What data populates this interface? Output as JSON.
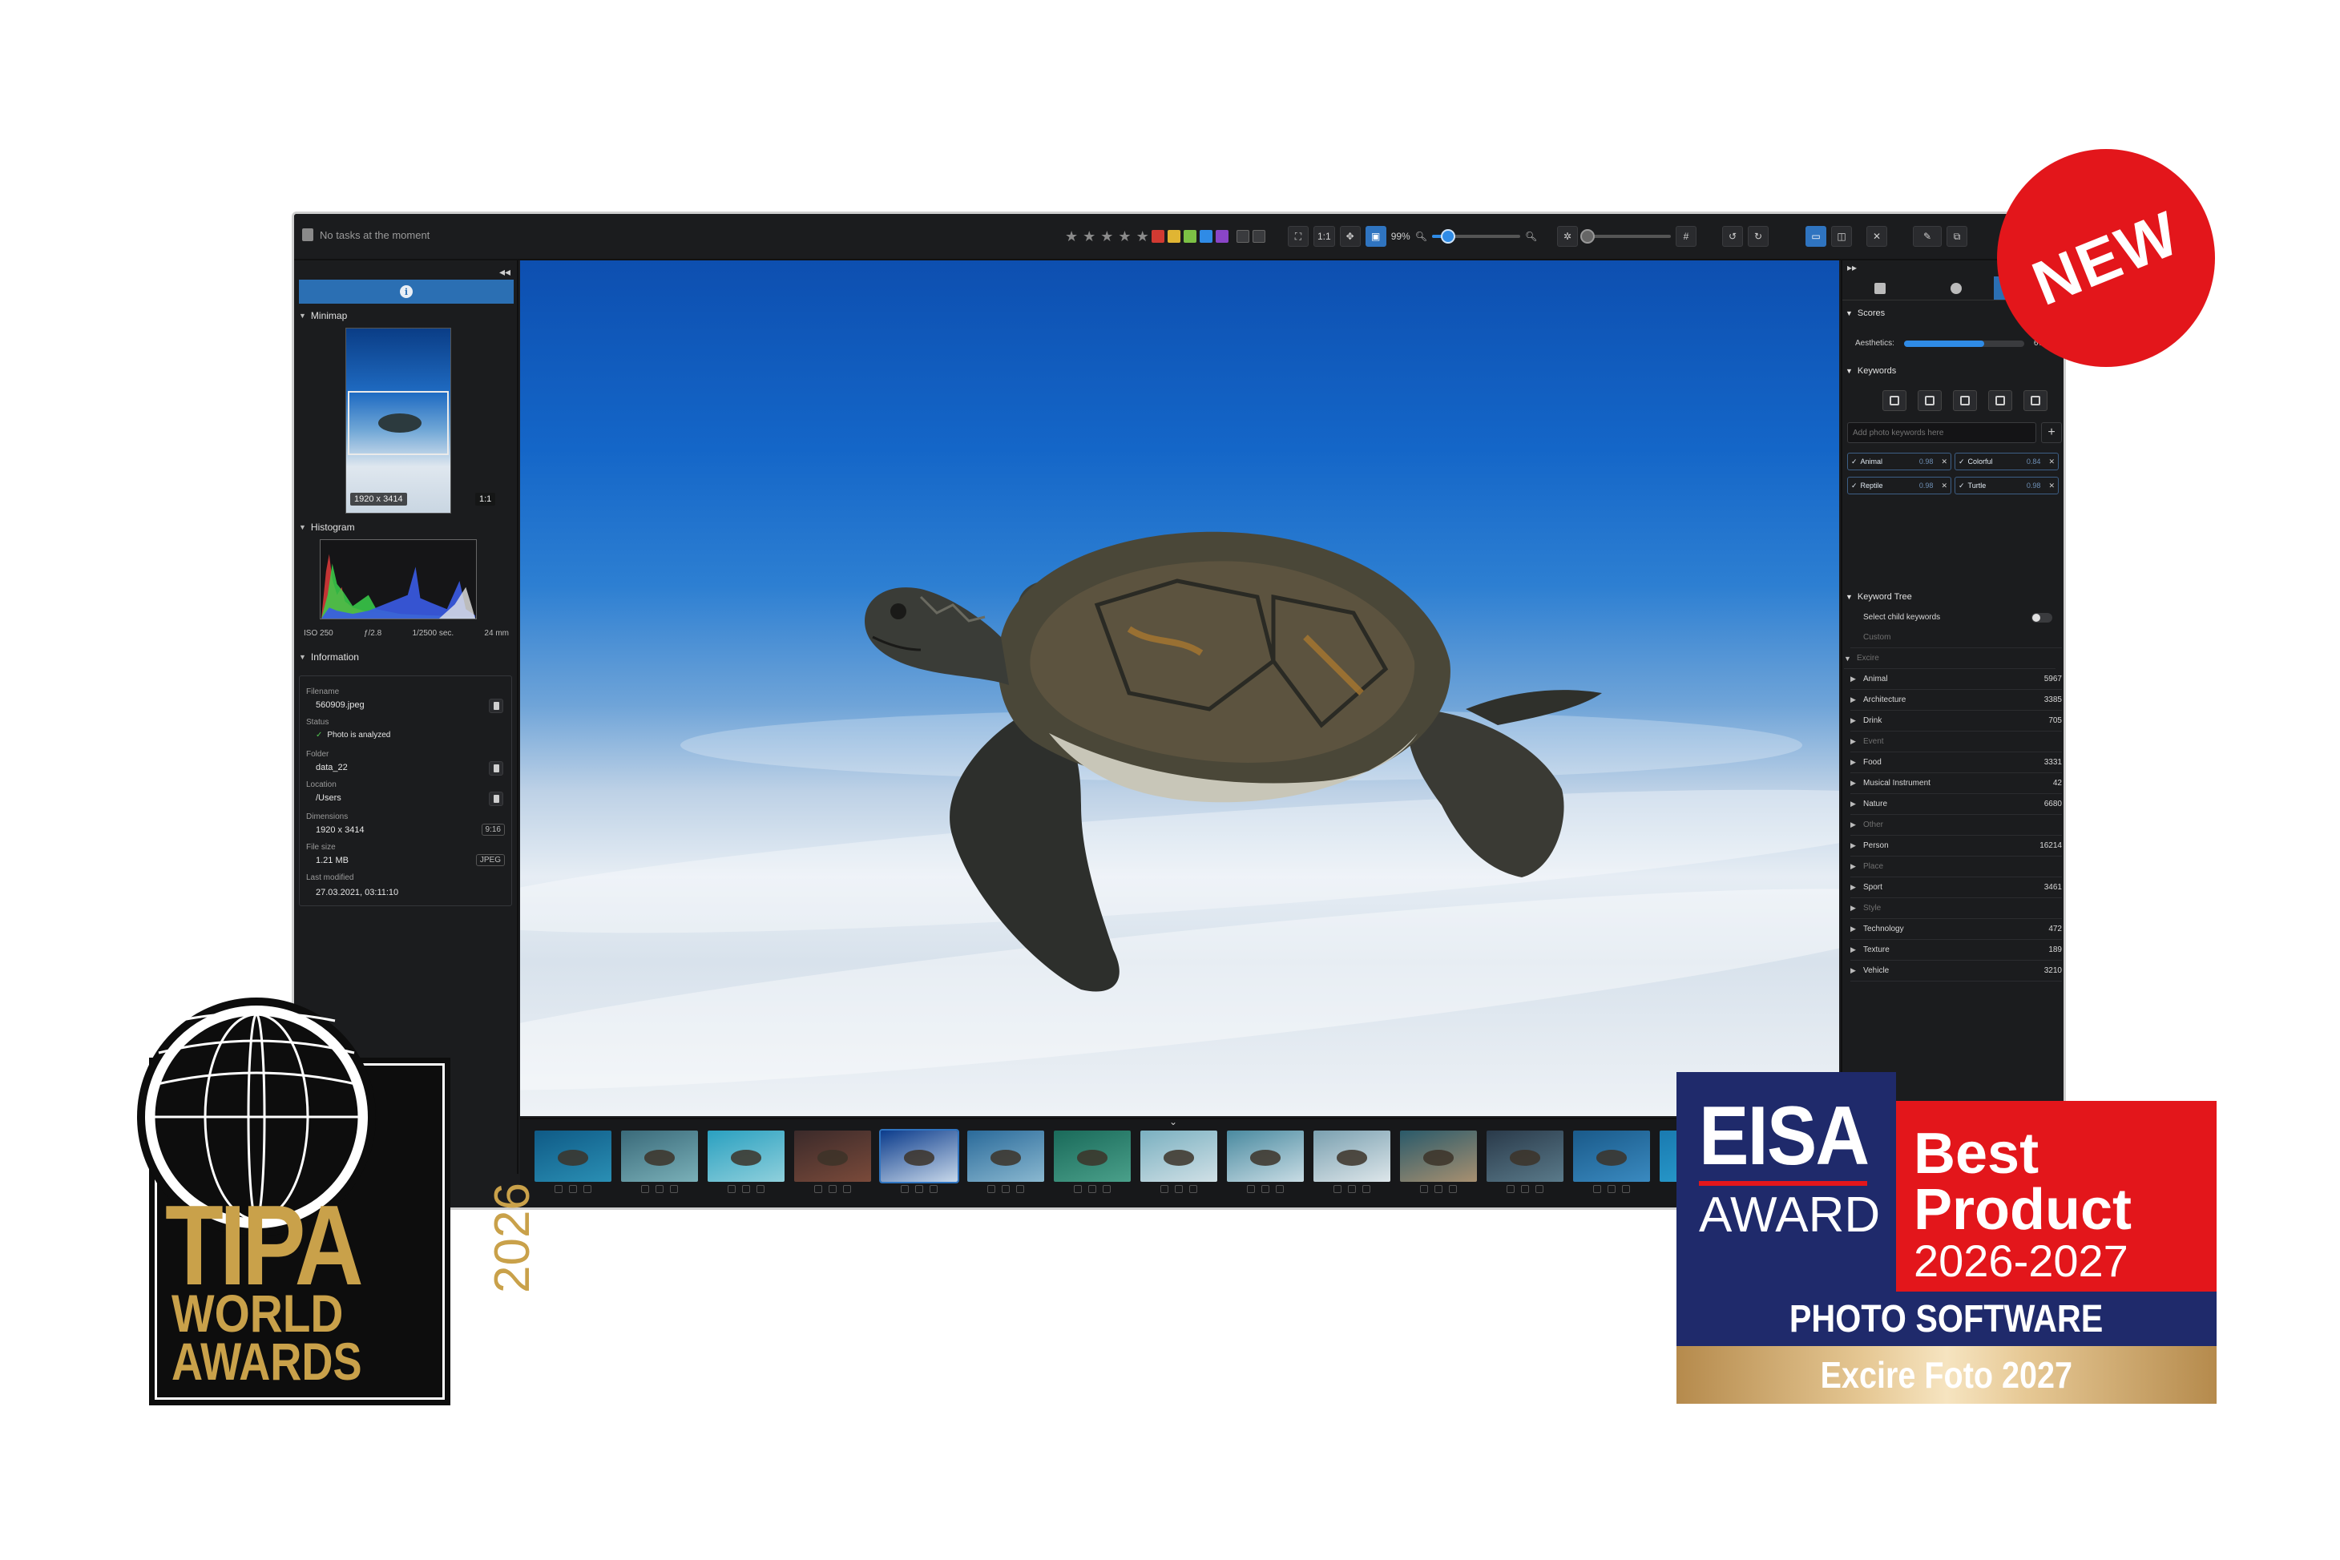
{
  "toolbar": {
    "task_status": "No tasks at the moment",
    "zoom_ratio": "1:1",
    "zoom_percent": "99%",
    "zoom_level": 0.18,
    "compare_level": 0.05
  },
  "left_panel": {
    "minimap": {
      "title": "Minimap",
      "dimensions_badge": "1920 x 3414",
      "ratio_badge": "1:1"
    },
    "histogram": {
      "title": "Histogram",
      "iso": "ISO 250",
      "aperture": "ƒ/2.8",
      "shutter": "1/2500 sec.",
      "focal": "24 mm"
    },
    "information": {
      "title": "Information",
      "filename_label": "Filename",
      "filename": "560909.jpeg",
      "status_label": "Status",
      "status": "Photo is analyzed",
      "folder_label": "Folder",
      "folder": "data_22",
      "location_label": "Location",
      "location": "/Users",
      "dimensions_label": "Dimensions",
      "dimensions": "1920 x 3414",
      "dimensions_ratio": "9:16",
      "filesize_label": "File size",
      "filesize": "1.21 MB",
      "filetype": "JPEG",
      "modified_label": "Last modified",
      "modified": "27.03.2021, 03:11:10"
    }
  },
  "right_panel": {
    "scores": {
      "title": "Scores",
      "aesthetics_label": "Aesthetics:",
      "aesthetics_value": "67",
      "aesthetics_level": 0.67
    },
    "keywords": {
      "title": "Keywords",
      "input_placeholder": "Add photo keywords here",
      "add_label": "+",
      "chips": [
        {
          "name": "Animal",
          "score": "0.98"
        },
        {
          "name": "Colorful",
          "score": "0.84"
        },
        {
          "name": "Reptile",
          "score": "0.98"
        },
        {
          "name": "Turtle",
          "score": "0.98"
        }
      ]
    },
    "keyword_tree": {
      "title": "Keyword Tree",
      "select_child_label": "Select child keywords",
      "custom_label": "Custom",
      "root_label": "Excire",
      "items": [
        {
          "name": "Animal",
          "count": "5967"
        },
        {
          "name": "Architecture",
          "count": "3385"
        },
        {
          "name": "Drink",
          "count": "705"
        },
        {
          "name": "Event",
          "count": ""
        },
        {
          "name": "Food",
          "count": "3331"
        },
        {
          "name": "Musical Instrument",
          "count": "42"
        },
        {
          "name": "Nature",
          "count": "6680"
        },
        {
          "name": "Other",
          "count": ""
        },
        {
          "name": "Person",
          "count": "16214"
        },
        {
          "name": "Place",
          "count": ""
        },
        {
          "name": "Sport",
          "count": "3461"
        },
        {
          "name": "Style",
          "count": ""
        },
        {
          "name": "Technology",
          "count": "472"
        },
        {
          "name": "Texture",
          "count": "189"
        },
        {
          "name": "Vehicle",
          "count": "3210"
        }
      ]
    }
  },
  "badges": {
    "new": "NEW"
  },
  "tipa": {
    "line1": "TIPA",
    "line2": "WORLD",
    "line3": "AWARDS",
    "year": "2026"
  },
  "eisa": {
    "logo": "EISA",
    "award": "AWARD",
    "best": "Best",
    "product": "Product",
    "years": "2026-2027",
    "category": "PHOTO SOFTWARE",
    "product_name": "Excire Foto 2027"
  },
  "colors": {
    "accent": "#2b6fb3",
    "new_badge": "#e3161b",
    "tipa_gold": "#c9a14a",
    "eisa_blue": "#1f2a6b",
    "eisa_red": "#e3161b"
  }
}
